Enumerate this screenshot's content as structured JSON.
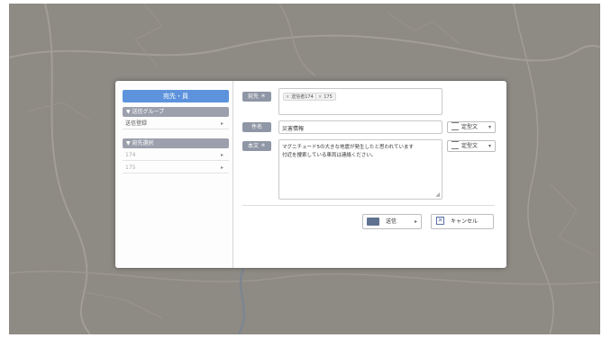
{
  "left_panel": {
    "recipient_button": "宛先・員",
    "sections": [
      {
        "header": "▼ 送信グループ",
        "rows": [
          {
            "label": "送信登録",
            "chevron": "▸"
          }
        ]
      },
      {
        "header": "▼ 宛先選択",
        "rows": [
          {
            "label": "174",
            "chevron": "▸"
          },
          {
            "label": "175",
            "chevron": "▸"
          }
        ]
      }
    ]
  },
  "form": {
    "recipient_label": "宛先 ＊",
    "recipient_chips": [
      {
        "x": "×",
        "text": "送信者174"
      },
      {
        "x": "×",
        "text": "175"
      }
    ],
    "subject_label": "件名",
    "subject_value": "災害情報",
    "subject_template_label": "定型文",
    "body_label": "本文 ＊",
    "body_template_label": "定型文",
    "body_lines": [
      "マグニチュード5の大きな地震が発生したと思われています",
      "付近を捜索している車両は連絡ください。"
    ],
    "dropdown_glyph": "▾"
  },
  "actions": {
    "send_label": "送信",
    "send_dropdown": "▸",
    "cancel_label": "キャンセル",
    "cancel_icon": "✕"
  }
}
